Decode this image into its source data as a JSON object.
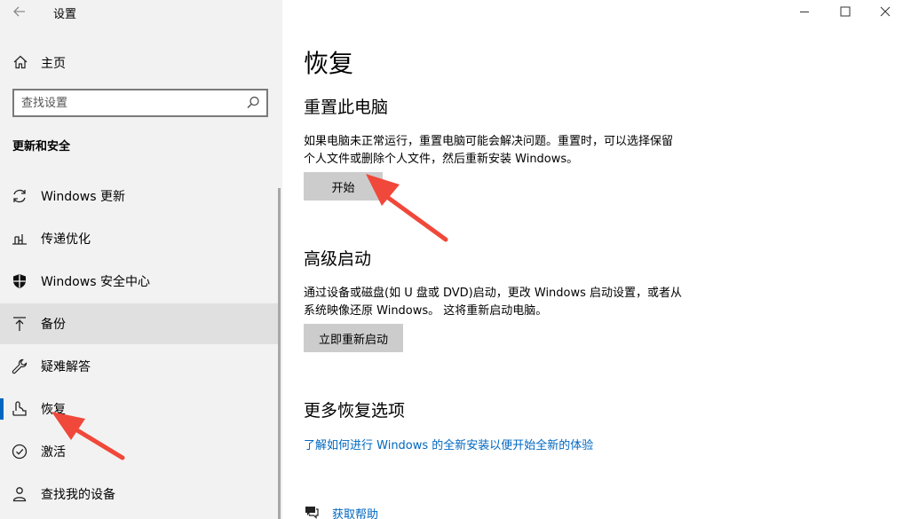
{
  "window": {
    "title": "设置"
  },
  "sidebar": {
    "home_label": "主页",
    "search_placeholder": "查找设置",
    "section_heading": "更新和安全",
    "items": [
      {
        "label": "Windows 更新",
        "icon": "refresh-icon"
      },
      {
        "label": "传递优化",
        "icon": "delivery-optimization-icon"
      },
      {
        "label": "Windows 安全中心",
        "icon": "shield-icon"
      },
      {
        "label": "备份",
        "icon": "backup-arrow-icon"
      },
      {
        "label": "疑难解答",
        "icon": "wrench-icon"
      },
      {
        "label": "恢复",
        "icon": "recovery-icon",
        "selected": true
      },
      {
        "label": "激活",
        "icon": "check-circle-icon"
      },
      {
        "label": "查找我的设备",
        "icon": "person-locate-icon"
      }
    ]
  },
  "main": {
    "title": "恢复",
    "reset": {
      "heading": "重置此电脑",
      "desc_line1": "如果电脑未正常运行，重置电脑可能会解决问题。重置时，可以选择保留",
      "desc_line2": "个人文件或删除个人文件，然后重新安装 Windows。",
      "button": "开始"
    },
    "advanced": {
      "heading": "高级启动",
      "desc_line1": "通过设备或磁盘(如 U 盘或 DVD)启动，更改 Windows 启动设置，或者从",
      "desc_line2": "系统映像还原 Windows。 这将重新启动电脑。",
      "button": "立即重新启动"
    },
    "more": {
      "heading": "更多恢复选项",
      "link": "了解如何进行 Windows 的全新安装以便开始全新的体验"
    },
    "help_label": "获取帮助"
  },
  "colors": {
    "accent": "#0067c0",
    "sidebar_bg": "#f2f2f2",
    "button_bg": "#cccccc",
    "annotation_arrow": "#f0483a"
  }
}
